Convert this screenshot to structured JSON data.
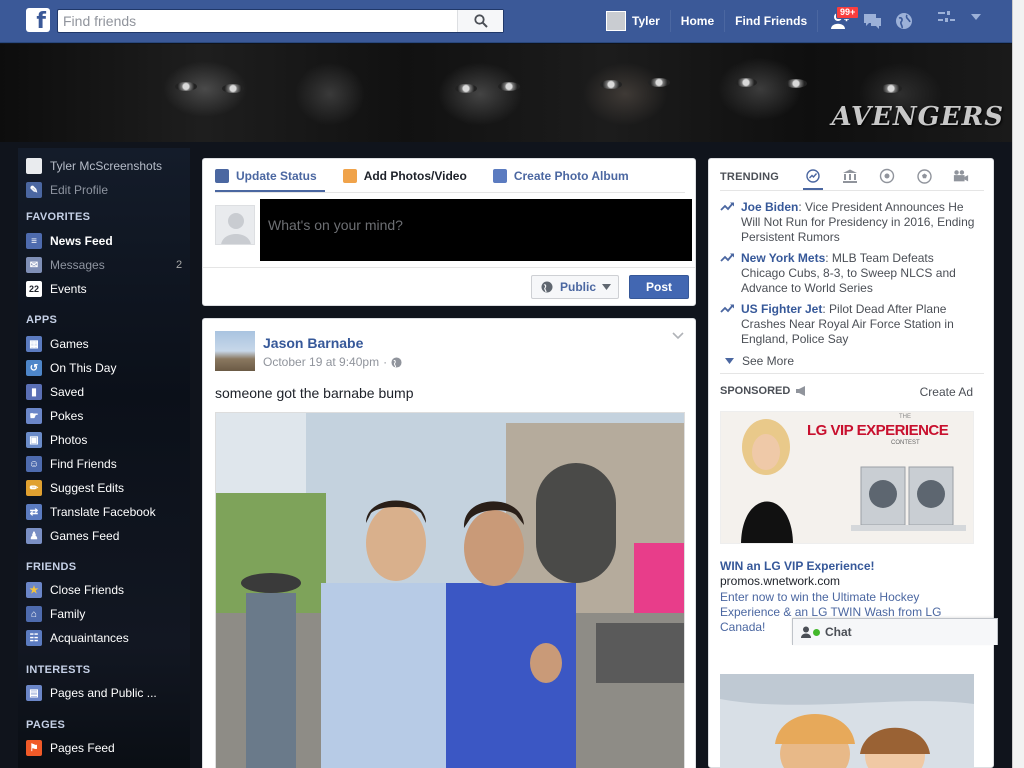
{
  "topbar": {
    "logo": "f",
    "search_placeholder": "Find friends",
    "user_name": "Tyler",
    "home": "Home",
    "find_friends": "Find Friends",
    "notif_count": "99+"
  },
  "cover": {
    "logo_text": "AVENGERS"
  },
  "leftnav": {
    "profile_name": "Tyler McScreenshots",
    "edit_profile": "Edit Profile",
    "favorites_head": "FAVORITES",
    "favorites": [
      {
        "label": "News Feed",
        "icon": "news-feed-icon"
      },
      {
        "label": "Messages",
        "icon": "messages-icon",
        "count": "2"
      },
      {
        "label": "Events",
        "icon": "events-icon",
        "badge": "22"
      }
    ],
    "apps_head": "APPS",
    "apps": [
      {
        "label": "Games",
        "icon": "games-icon"
      },
      {
        "label": "On This Day",
        "icon": "on-this-day-icon"
      },
      {
        "label": "Saved",
        "icon": "saved-icon"
      },
      {
        "label": "Pokes",
        "icon": "pokes-icon"
      },
      {
        "label": "Photos",
        "icon": "photos-icon"
      },
      {
        "label": "Find Friends",
        "icon": "find-friends-icon"
      },
      {
        "label": "Suggest Edits",
        "icon": "suggest-edits-icon"
      },
      {
        "label": "Translate Facebook",
        "icon": "translate-icon"
      },
      {
        "label": "Games Feed",
        "icon": "games-feed-icon"
      }
    ],
    "friends_head": "FRIENDS",
    "friends": [
      {
        "label": "Close Friends",
        "icon": "close-friends-icon"
      },
      {
        "label": "Family",
        "icon": "family-icon"
      },
      {
        "label": "Acquaintances",
        "icon": "acquaintances-icon"
      }
    ],
    "interests_head": "INTERESTS",
    "interests": [
      {
        "label": "Pages and Public ...",
        "icon": "pages-public-icon"
      }
    ],
    "pages_head": "PAGES",
    "pages": [
      {
        "label": "Pages Feed",
        "icon": "pages-feed-icon"
      }
    ]
  },
  "composer": {
    "tab_update": "Update Status",
    "tab_photos": "Add Photos/Video",
    "tab_album": "Create Photo Album",
    "placeholder": "What's on your mind?",
    "audience": "Public",
    "post": "Post"
  },
  "story": {
    "author": "Jason Barnabe",
    "time": "October 19 at 9:40pm",
    "text": "someone got the barnabe bump"
  },
  "trending": {
    "head": "TRENDING",
    "items": [
      {
        "topic": "Joe Biden",
        "text": ": Vice President Announces He Will Not Run for Presidency in 2016, Ending Persistent Rumors"
      },
      {
        "topic": "New York Mets",
        "text": ": MLB Team Defeats Chicago Cubs, 8-3, to Sweep NLCS and Advance to World Series"
      },
      {
        "topic": "US Fighter Jet",
        "text": ": Pilot Dead After Plane Crashes Near Royal Air Force Station in England, Police Say"
      }
    ],
    "see_more": "See More"
  },
  "sponsored": {
    "head": "SPONSORED",
    "create_ad": "Create Ad",
    "ad_image_title": "LG VIP EXPERIENCE",
    "ad_image_the": "THE",
    "ad_image_contest": "CONTEST",
    "ad_title": "WIN an LG VIP Experience!",
    "ad_domain": "promos.wnetwork.com",
    "ad_desc": "Enter now to win the Ultimate Hockey Experience & an LG TWIN Wash from LG Canada!"
  },
  "chat": {
    "label": "Chat"
  },
  "colors": {
    "brand": "#3b5998",
    "link": "#365899",
    "post_button": "#4267b2"
  }
}
